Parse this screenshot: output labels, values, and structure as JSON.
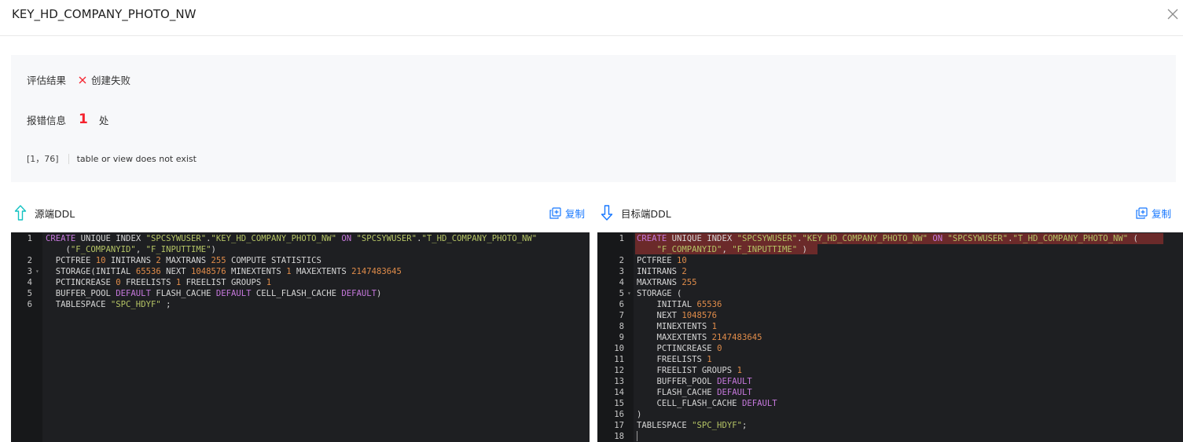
{
  "dialog": {
    "title": "KEY_HD_COMPANY_PHOTO_NW"
  },
  "assessment": {
    "result_label": "评估结果",
    "result_value": "创建失败",
    "error_label": "报错信息",
    "error_count": "1",
    "error_unit": "处",
    "error_position": "[1，76]",
    "error_message": "table or view does not exist"
  },
  "source": {
    "title": "源端DDL",
    "copy_label": "复制",
    "lines": [
      {
        "n": "1",
        "tokens": [
          [
            "kw",
            "CREATE"
          ],
          [
            "t",
            " UNIQUE INDEX "
          ],
          [
            "str",
            "\"SPCSYWUSER\""
          ],
          [
            "t",
            "."
          ],
          [
            "str",
            "\"KEY_HD_COMPANY_PHOTO_NW\""
          ],
          [
            "t",
            " "
          ],
          [
            "kw",
            "ON"
          ],
          [
            "t",
            " "
          ],
          [
            "str",
            "\"SPCSYWUSER\""
          ],
          [
            "t",
            "."
          ],
          [
            "str",
            "\"T_HD_COMPANY_PHOTO_NW\""
          ]
        ]
      },
      {
        "n": "",
        "tokens": [
          [
            "t",
            "    ("
          ],
          [
            "str",
            "\"F_COMPANYID\""
          ],
          [
            "t",
            ", "
          ],
          [
            "str",
            "\"F_INPUTTIME\""
          ],
          [
            "t",
            ")"
          ]
        ]
      },
      {
        "n": "2",
        "tokens": [
          [
            "t",
            "  PCTFREE "
          ],
          [
            "num",
            "10"
          ],
          [
            "t",
            " INITRANS "
          ],
          [
            "num",
            "2"
          ],
          [
            "t",
            " MAXTRANS "
          ],
          [
            "num",
            "255"
          ],
          [
            "t",
            " COMPUTE STATISTICS"
          ]
        ]
      },
      {
        "n": "3",
        "fold": true,
        "tokens": [
          [
            "t",
            "  STORAGE(INITIAL "
          ],
          [
            "num",
            "65536"
          ],
          [
            "t",
            " NEXT "
          ],
          [
            "num",
            "1048576"
          ],
          [
            "t",
            " MINEXTENTS "
          ],
          [
            "num",
            "1"
          ],
          [
            "t",
            " MAXEXTENTS "
          ],
          [
            "num",
            "2147483645"
          ]
        ]
      },
      {
        "n": "4",
        "tokens": [
          [
            "t",
            "  PCTINCREASE "
          ],
          [
            "num",
            "0"
          ],
          [
            "t",
            " FREELISTS "
          ],
          [
            "num",
            "1"
          ],
          [
            "t",
            " FREELIST GROUPS "
          ],
          [
            "num",
            "1"
          ]
        ]
      },
      {
        "n": "5",
        "tokens": [
          [
            "t",
            "  BUFFER_POOL "
          ],
          [
            "kw",
            "DEFAULT"
          ],
          [
            "t",
            " FLASH_CACHE "
          ],
          [
            "kw",
            "DEFAULT"
          ],
          [
            "t",
            " CELL_FLASH_CACHE "
          ],
          [
            "kw",
            "DEFAULT"
          ],
          [
            "t",
            ")"
          ]
        ]
      },
      {
        "n": "6",
        "tokens": [
          [
            "t",
            "  TABLESPACE "
          ],
          [
            "str",
            "\"SPC_HDYF\""
          ],
          [
            "t",
            " ;"
          ]
        ]
      }
    ]
  },
  "target": {
    "title": "目标端DDL",
    "copy_label": "复制",
    "lines": [
      {
        "n": "1",
        "tokens": [
          [
            "kw",
            "CREATE"
          ],
          [
            "t",
            " UNIQUE INDEX "
          ],
          [
            "str",
            "\"SPCSYWUSER\""
          ],
          [
            "t",
            "."
          ],
          [
            "str",
            "\"KEY_HD_COMPANY_PHOTO_NW\""
          ],
          [
            "t",
            " "
          ],
          [
            "kw",
            "ON"
          ],
          [
            "t",
            " "
          ],
          [
            "str",
            "\"SPCSYWUSER\""
          ],
          [
            "t",
            "."
          ],
          [
            "str",
            "\"T_HD_COMPANY_PHOTO_NW\""
          ],
          [
            "t",
            " ("
          ]
        ]
      },
      {
        "n": "",
        "tokens": [
          [
            "t",
            "    "
          ],
          [
            "str",
            "\"F_COMPANYID\""
          ],
          [
            "t",
            ", "
          ],
          [
            "str",
            "\"F_INPUTTIME\""
          ],
          [
            "t",
            " )"
          ]
        ]
      },
      {
        "n": "2",
        "tokens": [
          [
            "t",
            "PCTFREE "
          ],
          [
            "num",
            "10"
          ]
        ]
      },
      {
        "n": "3",
        "tokens": [
          [
            "t",
            "INITRANS "
          ],
          [
            "num",
            "2"
          ]
        ]
      },
      {
        "n": "4",
        "tokens": [
          [
            "t",
            "MAXTRANS "
          ],
          [
            "num",
            "255"
          ]
        ]
      },
      {
        "n": "5",
        "fold": true,
        "tokens": [
          [
            "t",
            "STORAGE ("
          ]
        ]
      },
      {
        "n": "6",
        "tokens": [
          [
            "t",
            "    INITIAL "
          ],
          [
            "num",
            "65536"
          ]
        ]
      },
      {
        "n": "7",
        "tokens": [
          [
            "t",
            "    NEXT "
          ],
          [
            "num",
            "1048576"
          ]
        ]
      },
      {
        "n": "8",
        "tokens": [
          [
            "t",
            "    MINEXTENTS "
          ],
          [
            "num",
            "1"
          ]
        ]
      },
      {
        "n": "9",
        "tokens": [
          [
            "t",
            "    MAXEXTENTS "
          ],
          [
            "num",
            "2147483645"
          ]
        ]
      },
      {
        "n": "10",
        "tokens": [
          [
            "t",
            "    PCTINCREASE "
          ],
          [
            "num",
            "0"
          ]
        ]
      },
      {
        "n": "11",
        "tokens": [
          [
            "t",
            "    FREELISTS "
          ],
          [
            "num",
            "1"
          ]
        ]
      },
      {
        "n": "12",
        "tokens": [
          [
            "t",
            "    FREELIST GROUPS "
          ],
          [
            "num",
            "1"
          ]
        ]
      },
      {
        "n": "13",
        "tokens": [
          [
            "t",
            "    BUFFER_POOL "
          ],
          [
            "kw",
            "DEFAULT"
          ]
        ]
      },
      {
        "n": "14",
        "tokens": [
          [
            "t",
            "    FLASH_CACHE "
          ],
          [
            "kw",
            "DEFAULT"
          ]
        ]
      },
      {
        "n": "15",
        "tokens": [
          [
            "t",
            "    CELL_FLASH_CACHE "
          ],
          [
            "kw",
            "DEFAULT"
          ]
        ]
      },
      {
        "n": "16",
        "tokens": [
          [
            "t",
            ")"
          ]
        ]
      },
      {
        "n": "17",
        "tokens": [
          [
            "t",
            "TABLESPACE "
          ],
          [
            "str",
            "\"SPC_HDYF\""
          ],
          [
            "t",
            ";"
          ]
        ]
      },
      {
        "n": "18",
        "tokens": []
      }
    ]
  },
  "colors": {
    "accent": "#1677ff",
    "source_arrow": "#13c2c2",
    "error": "#f5222d",
    "editor_bg": "#1e1f22",
    "error_highlight": "#6b2a2a"
  }
}
